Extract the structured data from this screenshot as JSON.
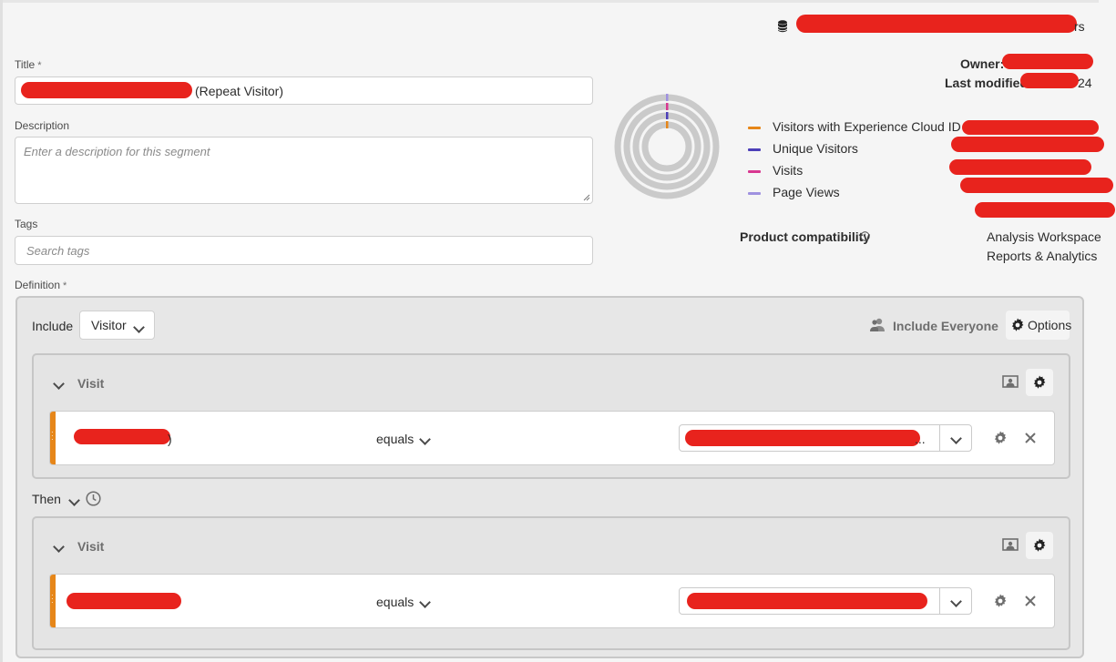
{
  "header": {
    "data_source_suffix": "rs"
  },
  "form": {
    "title_label": "Title",
    "required_mark": "*",
    "title_value_suffix": "(Repeat Visitor)",
    "description_label": "Description",
    "description_placeholder": "Enter a description for this segment",
    "tags_label": "Tags",
    "tags_placeholder": "Search tags",
    "definition_label": "Definition"
  },
  "meta": {
    "owner_label": "Owner:",
    "last_modified_label": "Last modified:",
    "last_modified_suffix": "24"
  },
  "legend": [
    {
      "label": "Visitors with Experience Cloud ID",
      "color": "#e68619"
    },
    {
      "label": "Unique Visitors",
      "color": "#4c3fb8"
    },
    {
      "label": "Visits",
      "color": "#d83790"
    },
    {
      "label": "Page Views",
      "color": "#9f91e0"
    }
  ],
  "compatibility": {
    "label": "Product compatibility",
    "products": [
      "Analysis Workspace",
      "Reports & Analytics"
    ]
  },
  "definition": {
    "include_label": "Include",
    "scope_value": "Visitor",
    "include_everyone_label": "Include Everyone",
    "options_label": "Options",
    "then_label": "Then",
    "containers": [
      {
        "title": "Visit",
        "rule": {
          "operator": "equals",
          "name_suffix": ")",
          "value_suffix": "..."
        }
      },
      {
        "title": "Visit",
        "rule": {
          "operator": "equals",
          "name_suffix": "",
          "value_suffix": ""
        }
      }
    ]
  }
}
